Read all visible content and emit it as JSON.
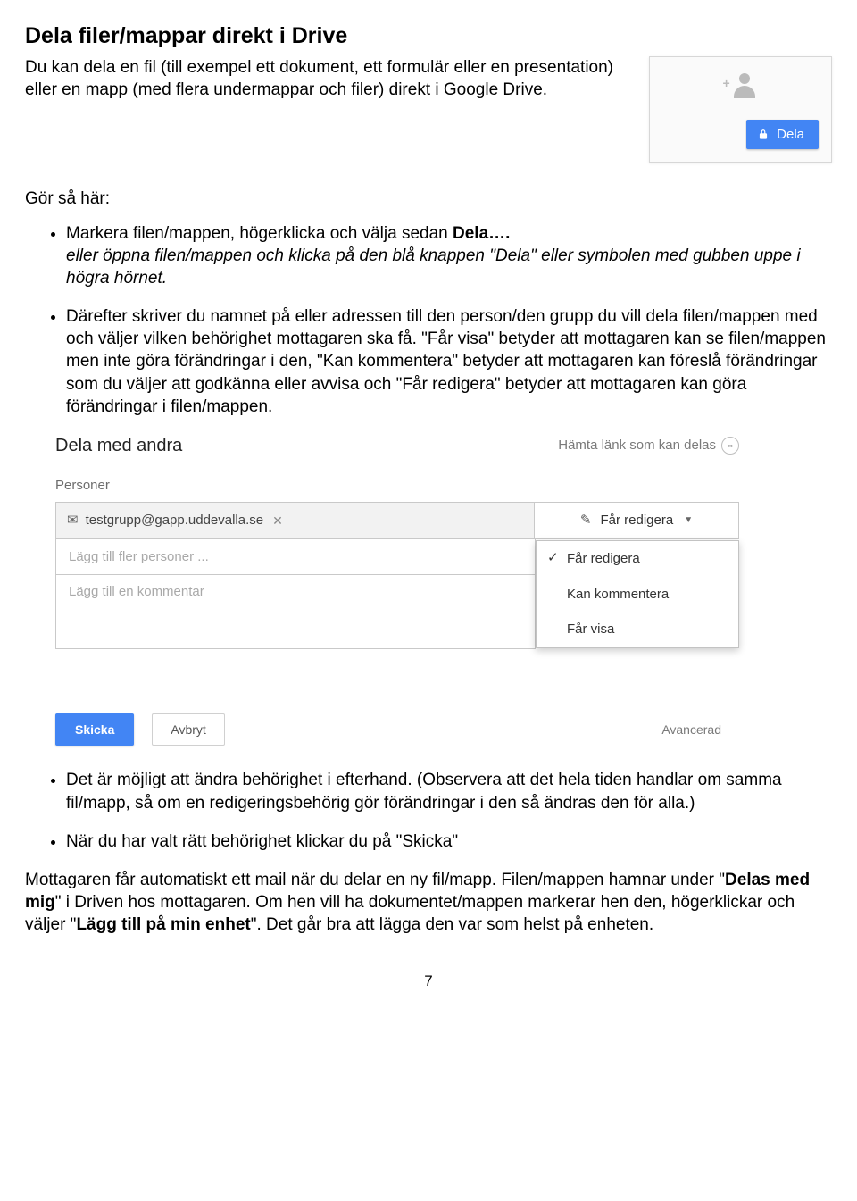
{
  "title": "Dela filer/mappar direkt i Drive",
  "intro": "Du kan dela en fil (till exempel ett dokument, ett formulär eller en presentation) eller en mapp (med flera undermappar och filer) direkt i Google Drive.",
  "share_widget": {
    "button_label": "Dela"
  },
  "instructions": {
    "lead": "Gör så här:",
    "item1_a": "Markera filen/mappen, högerklicka och välja sedan ",
    "item1_b": "Dela….",
    "item1_c": "eller öppna filen/mappen och klicka på den blå knappen \"Dela\" eller symbolen med gubben uppe i högra hörnet.",
    "item2": "Därefter skriver du namnet på eller adressen till den person/den grupp du vill dela filen/mappen med och väljer vilken behörighet mottagaren ska få. \"Får visa\" betyder att mottagaren kan se filen/mappen men inte göra förändringar i den, \"Kan kommentera\" betyder att mottagaren kan föreslå förändringar som du väljer att godkänna eller avvisa och \"Får redigera\" betyder att mottagaren kan göra förändringar i filen/mappen."
  },
  "dialog": {
    "title": "Dela med andra",
    "link_share": "Hämta länk som kan delas",
    "persons_label": "Personer",
    "chip_email": "testgrupp@gapp.uddevalla.se",
    "permission_label": "Får redigera",
    "add_more_placeholder": "Lägg till fler personer ...",
    "comment_placeholder": "Lägg till en kommentar",
    "options": {
      "edit": "Får redigera",
      "comment": "Kan kommentera",
      "view": "Får visa"
    },
    "send": "Skicka",
    "cancel": "Avbryt",
    "advanced": "Avancerad"
  },
  "after": {
    "b1": "Det är möjligt att ändra behörighet i efterhand. (Observera att det hela tiden handlar om samma fil/mapp, så om en redigeringsbehörig gör förändringar i den så ändras den för alla.)",
    "b2": "När du har valt rätt behörighet klickar du på \"Skicka\""
  },
  "closing": {
    "p1a": "Mottagaren får automatiskt ett mail när du delar en ny fil/mapp. Filen/mappen hamnar under \"",
    "p1b": "Delas med mig",
    "p1c": "\" i Driven hos mottagaren. Om hen vill ha dokumentet/mappen markerar hen den, högerklickar och väljer \"",
    "p1d": "Lägg till på min enhet",
    "p1e": "\". Det går bra att lägga den var som helst på enheten."
  },
  "page_number": "7"
}
